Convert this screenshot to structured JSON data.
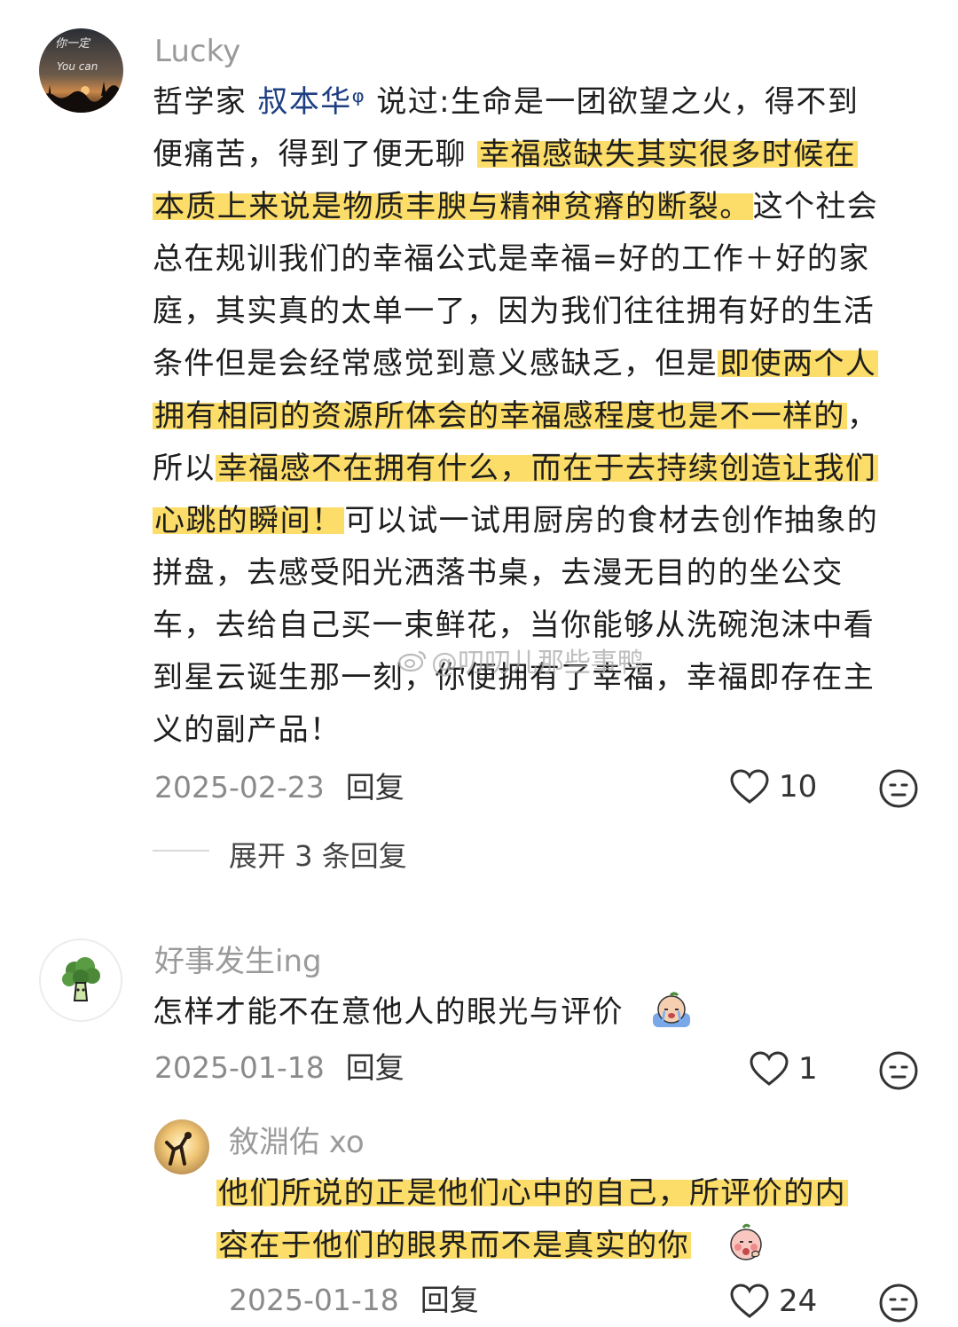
{
  "comments": [
    {
      "user": "Lucky",
      "avatar_text": [
        "你一定",
        "You can"
      ],
      "lines": [
        [
          {
            "t": "哲学家 "
          },
          {
            "t": "叔本华",
            "link": true
          },
          {
            "t": "ᵠ",
            "link": true
          },
          {
            "t": " 说过:生命是一团欲望之火，得不到"
          }
        ],
        [
          {
            "t": "便痛苦，得到了便无聊 "
          },
          {
            "t": "幸福感缺失其实很多时候在",
            "hl": true
          }
        ],
        [
          {
            "t": "本质上来说是物质丰腴与精神贫瘠的断裂。",
            "hl": true
          },
          {
            "t": "这个社会"
          }
        ],
        [
          {
            "t": "总在规训我们的幸福公式是幸福=好的工作＋好的家"
          }
        ],
        [
          {
            "t": "庭，其实真的太单一了，因为我们往往拥有好的生活"
          }
        ],
        [
          {
            "t": "条件但是会经常感觉到意义感缺乏，但是"
          },
          {
            "t": "即使两个人",
            "hl": true
          }
        ],
        [
          {
            "t": "拥有相同的资源所体会的幸福感程度也是不一样的",
            "hl": true
          },
          {
            "t": "，"
          }
        ],
        [
          {
            "t": "所以"
          },
          {
            "t": "幸福感不在拥有什么，而在于去持续创造让我们",
            "hl": true
          }
        ],
        [
          {
            "t": "心跳的瞬间！",
            "hl": true
          },
          {
            "t": "可以试一试用厨房的食材去创作抽象的"
          }
        ],
        [
          {
            "t": "拼盘，去感受阳光洒落书桌，去漫无目的的坐公交"
          }
        ],
        [
          {
            "t": "车，去给自己买一束鲜花，当你能够从洗碗泡沫中看"
          }
        ],
        [
          {
            "t": "到星云诞生那一刻，你便拥有了幸福，幸福即存在主"
          }
        ],
        [
          {
            "t": "义的副产品！"
          }
        ]
      ],
      "date": "2025-02-23",
      "reply_label": "回复",
      "likes": "10",
      "expand_label": "展开 3 条回复"
    },
    {
      "user": "好事发生ing",
      "lines": [
        [
          {
            "t": "怎样才能不在意他人的眼光与评价"
          }
        ]
      ],
      "date": "2025-01-18",
      "reply_label": "回复",
      "likes": "1"
    },
    {
      "user": "敘淵佑 xo",
      "lines": [
        [
          {
            "t": "他们所说的正是他们心中的自己，所评价的内",
            "hl": true
          }
        ],
        [
          {
            "t": "容在于他们的眼界而不是真实的你",
            "hl": true
          }
        ]
      ],
      "date": "2025-01-18",
      "reply_label": "回复",
      "likes": "24"
    }
  ],
  "watermark": "@叨叨儿那些事鸭",
  "colors": {
    "highlight": "#fcda5c",
    "link": "#1d3f82",
    "meta": "#8a8a8a"
  }
}
